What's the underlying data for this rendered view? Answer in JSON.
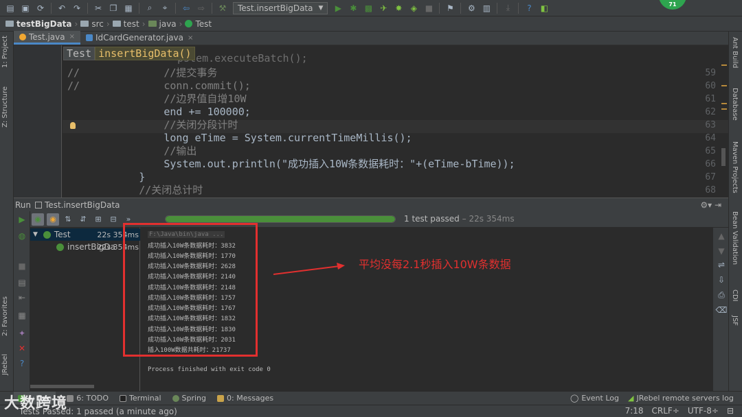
{
  "toolbar": {
    "run_config": "Test.insertBigData",
    "notification_count": "71"
  },
  "navbar": {
    "crumbs": [
      "testBigData",
      "src",
      "test",
      "java",
      "Test"
    ]
  },
  "editor_tabs": [
    {
      "label": "Test.java",
      "close": "×"
    },
    {
      "label": "IdCardGenerator.java",
      "close": "×"
    }
  ],
  "editor": {
    "breadcrumb_class": "Test",
    "breadcrumb_method": "insertBigData()",
    "lines": [
      {
        "n": "59",
        "prefix": "//",
        "code": "            //提交事务"
      },
      {
        "n": "60",
        "prefix": "//",
        "code": "            conn.commit();"
      },
      {
        "n": "61",
        "prefix": "",
        "code": "            //边界值自增10W"
      },
      {
        "n": "62",
        "prefix": "",
        "code": "            end += 100000;"
      },
      {
        "n": "63",
        "prefix": "",
        "code": "            //关闭分段计时"
      },
      {
        "n": "64",
        "prefix": "",
        "code": "            long eTime = System.currentTimeMillis();"
      },
      {
        "n": "65",
        "prefix": "",
        "code": "            //输出"
      },
      {
        "n": "66",
        "prefix": "",
        "code": "            System.out.println(\"成功插入10W条数据耗时：\"+(eTime-bTime));"
      },
      {
        "n": "67",
        "prefix": "",
        "code": "        }"
      },
      {
        "n": "68",
        "prefix": "",
        "code": "        //关闭总计时"
      }
    ],
    "top_partial": "pstem.executeBatch();"
  },
  "run_panel": {
    "label": "Run",
    "config": "Test.insertBigData",
    "progress_fraction": 1.0,
    "status": "1 test passed",
    "duration": "– 22s 354ms",
    "tree": [
      {
        "label": "Test",
        "time": "22s 354ms"
      },
      {
        "label": "insertBigDa",
        "time": "22s 354ms"
      }
    ]
  },
  "console": {
    "command": "F:\\Java\\bin\\java ...",
    "lines": [
      "成功插入10W条数据耗时：3832",
      "成功插入10W条数据耗时：1770",
      "成功插入10W条数据耗时：2628",
      "成功插入10W条数据耗时：2140",
      "成功插入10W条数据耗时：2148",
      "成功插入10W条数据耗时：1757",
      "成功插入10W条数据耗时：1767",
      "成功插入10W条数据耗时：1832",
      "成功插入10W条数据耗时：1830",
      "成功插入10W条数据耗时：2031",
      "插入100W数据共耗时：21737"
    ],
    "exit": "Process finished with exit code 0"
  },
  "annotation": "平均没每2.1秒插入10W条数据",
  "tool_tabs": {
    "left": [
      "4: Run",
      "6: TODO",
      "Terminal",
      "Spring",
      "0: Messages"
    ],
    "right": [
      "Event Log",
      "JRebel remote servers log"
    ]
  },
  "status": {
    "message": "Tests Passed: 1 passed (a minute ago)",
    "position": "7:18",
    "line_sep": "CRLF÷",
    "encoding": "UTF-8÷"
  },
  "side_tabs": {
    "left": [
      "1: Project",
      "Z: Structure",
      "2: Favorites",
      "JRebel"
    ],
    "right": [
      "Ant Build",
      "Database",
      "Maven Projects",
      "Bean Validation",
      "CDI",
      "JSF"
    ]
  },
  "watermark": "大数跨境",
  "colors": {
    "accent_red": "#e2302f",
    "pass_green": "#4a8f3a"
  }
}
